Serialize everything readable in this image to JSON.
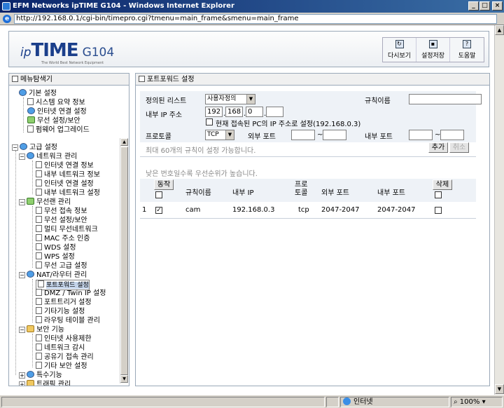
{
  "window": {
    "title": "EFM Networks ipTIME G104 - Windows Internet Explorer",
    "url": "http://192.168.0.1/cgi-bin/timepro.cgi?tmenu=main_frame&smenu=main_frame"
  },
  "header": {
    "logo_ip": "ip",
    "logo_time": "TIME",
    "logo_model": "G104",
    "logo_tagline": "The World Best Network Equipment",
    "buttons": [
      "다시보기",
      "설정저장",
      "도움말"
    ]
  },
  "menu": {
    "title": "메뉴탐색기",
    "basic": {
      "label": "기본 설정",
      "items": [
        "시스템 요약 정보",
        "인터넷 연결 설정",
        "무선 설정/보안",
        "펌웨어 업그레이드"
      ]
    },
    "advanced": {
      "label": "고급 설정",
      "network": {
        "label": "네트워크 관리",
        "items": [
          "인터넷 연결 정보",
          "내부 네트워크 정보",
          "인터넷 연결 설정",
          "내부 네트워크 설정"
        ]
      },
      "wireless": {
        "label": "무선랜 관리",
        "items": [
          "무선 접속 정보",
          "무선 설정/보안",
          "멀티 무선네트워크",
          "MAC 주소 인증",
          "WDS 설정",
          "WPS 설정",
          "무선 고급 설정"
        ]
      },
      "nat": {
        "label": "NAT/라우터 관리",
        "items": [
          "포트포워드 설정",
          "DMZ / Twin IP 설정",
          "포트트리거 설정",
          "기타기능 설정",
          "라우팅 테이블 관리"
        ]
      },
      "security": {
        "label": "보안 기능",
        "items": [
          "인터넷 사용제한",
          "네트워크 감시",
          "공유기 접속 관리",
          "기타 보안 설정"
        ]
      },
      "special": {
        "label": "특수기능"
      },
      "traffic": {
        "label": "트래픽 관리"
      }
    }
  },
  "main": {
    "title": "포트포워드 설정",
    "form": {
      "defined_list_label": "정의된 리스트",
      "defined_list_value": "사용자정의",
      "rule_name_label": "규칙이름",
      "rule_name_value": "",
      "internal_ip_label": "내부 IP 주소",
      "ip": [
        "192",
        "168",
        "0",
        ""
      ],
      "current_pc_label": "현재 접속된 PC의 IP 주소로 설정(192.168.0.3)",
      "protocol_label": "프로토콜",
      "protocol_value": "TCP",
      "external_port_label": "외부 포트",
      "internal_port_label": "내부 포트",
      "tilde": "~",
      "max_rules_note": "최대 60개의 규칙이 설정 가능합니다.",
      "add_button": "추가",
      "cancel_button": "취소"
    },
    "priority_note": "낮은 번호일수록 우선순위가 높습니다.",
    "table": {
      "action_button": "동작",
      "columns": [
        "규칙이름",
        "내부 IP",
        "프로토콜",
        "외부 포트",
        "내부 포트"
      ],
      "protocol_col_line1": "프로",
      "protocol_col_line2": "토콜",
      "delete_button": "삭제",
      "rows": [
        {
          "index": "1",
          "enabled": "✓",
          "name": "cam",
          "internal_ip": "192.168.0.3",
          "protocol": "tcp",
          "external_port": "2047-2047",
          "internal_port": "2047-2047"
        }
      ]
    }
  },
  "statusbar": {
    "zone": "인터넷",
    "zoom": "100%"
  }
}
